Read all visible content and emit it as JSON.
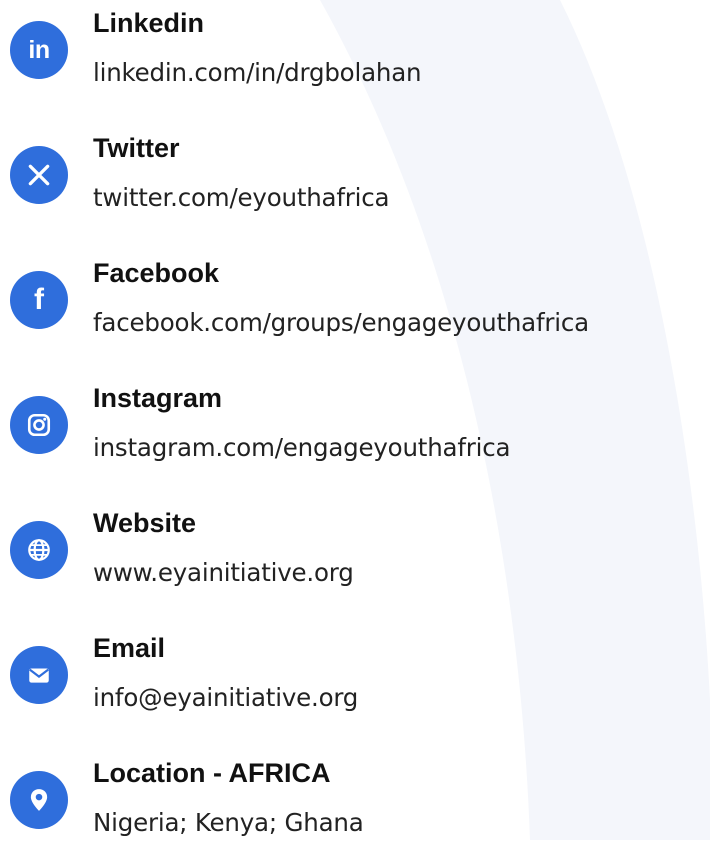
{
  "colors": {
    "icon_bg": "#2f6edc",
    "label": "#111111",
    "value": "#222222",
    "background_arc": "#f4f6fb"
  },
  "contacts": [
    {
      "icon": "linkedin-icon",
      "label": "Linkedin",
      "value": "linkedin.com/in/drgbolahan"
    },
    {
      "icon": "x-twitter-icon",
      "label": "Twitter",
      "value": "twitter.com/eyouthafrica"
    },
    {
      "icon": "facebook-icon",
      "label": "Facebook",
      "value": "facebook.com/groups/engageyouthafrica"
    },
    {
      "icon": "instagram-icon",
      "label": "Instagram",
      "value": "instagram.com/engageyouthafrica"
    },
    {
      "icon": "globe-icon",
      "label": "Website",
      "value": "www.eyainitiative.org"
    },
    {
      "icon": "envelope-icon",
      "label": "Email",
      "value": "info@eyainitiative.org"
    },
    {
      "icon": "location-pin-icon",
      "label": "Location - AFRICA",
      "value": "Nigeria; Kenya; Ghana"
    }
  ]
}
